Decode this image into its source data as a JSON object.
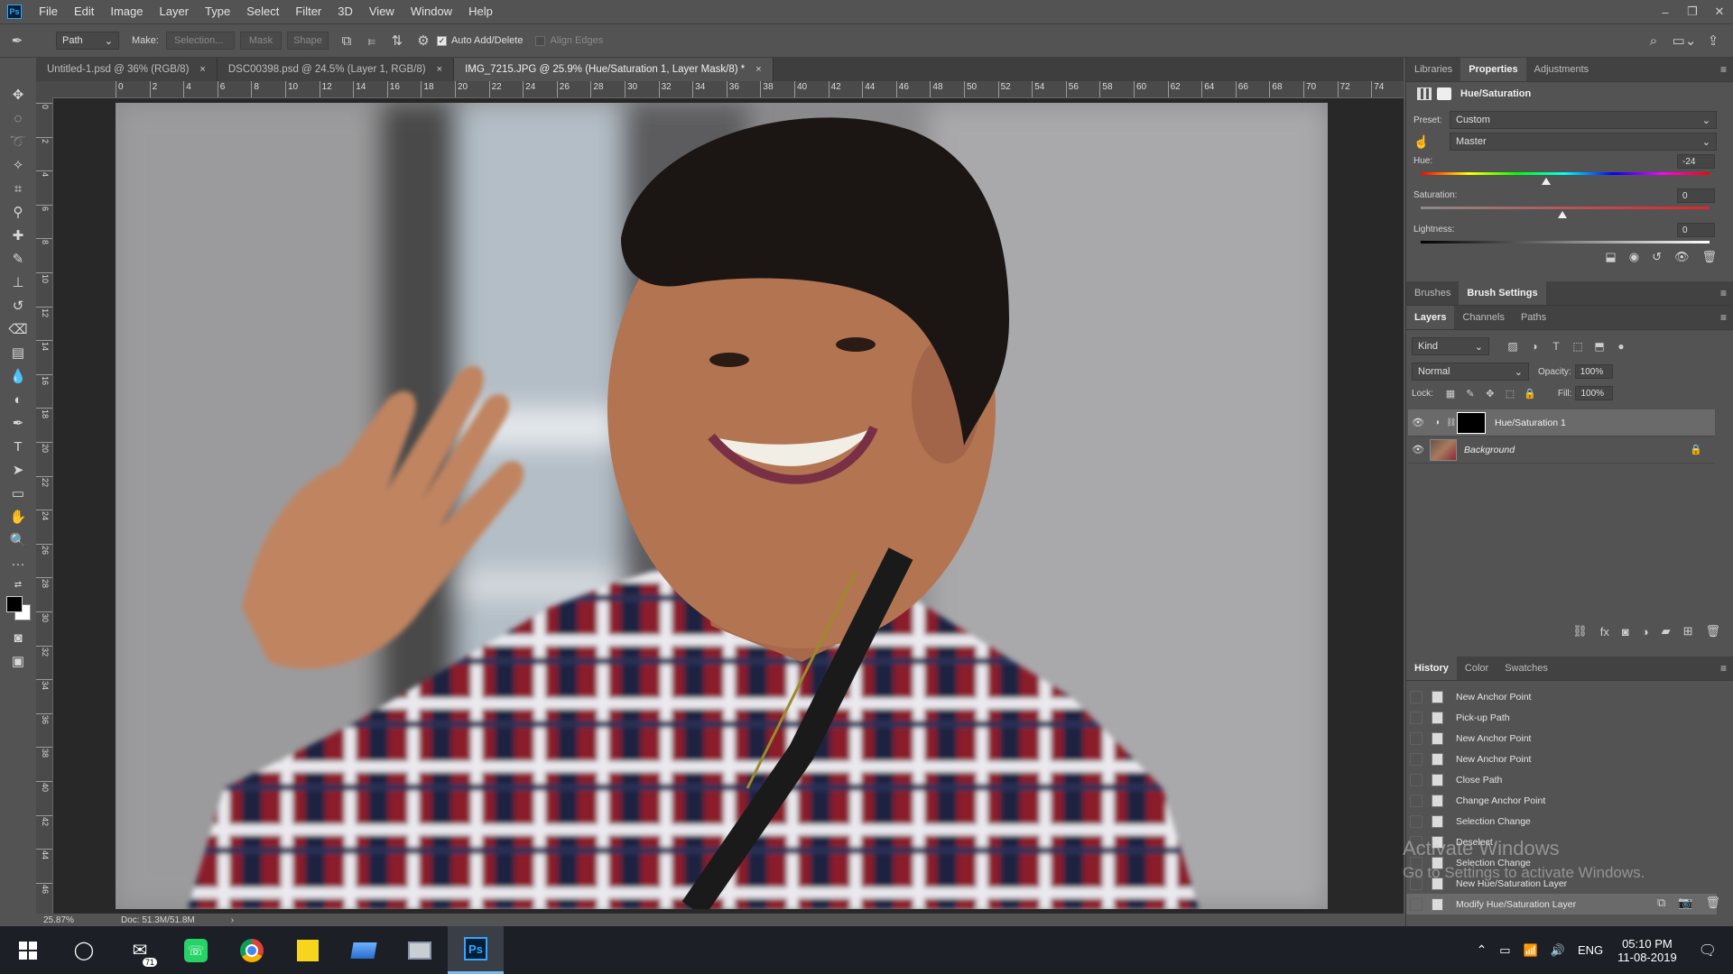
{
  "app": {
    "logo": "Ps"
  },
  "menu": [
    "File",
    "Edit",
    "Image",
    "Layer",
    "Type",
    "Select",
    "Filter",
    "3D",
    "View",
    "Window",
    "Help"
  ],
  "window_controls": {
    "minimize": "–",
    "restore": "❐",
    "close": "✕"
  },
  "options": {
    "tool_mode": "Path",
    "make_label": "Make:",
    "selection_btn": "Selection...",
    "mask_btn": "Mask",
    "shape_btn": "Shape",
    "auto_add_delete": "Auto Add/Delete",
    "align_edges": "Align Edges"
  },
  "tabs": [
    {
      "label": "Untitled-1.psd @ 36% (RGB/8)",
      "close": "×"
    },
    {
      "label": "DSC00398.psd @ 24.5% (Layer 1, RGB/8)",
      "close": "×"
    },
    {
      "label": "IMG_7215.JPG @ 25.9% (Hue/Saturation 1, Layer Mask/8) *",
      "close": "×"
    }
  ],
  "ruler_h": [
    "0",
    "2",
    "4",
    "6",
    "8",
    "10",
    "12",
    "14",
    "16",
    "18",
    "20",
    "22",
    "24",
    "26",
    "28",
    "30",
    "32",
    "34",
    "36",
    "38",
    "40",
    "42",
    "44",
    "46",
    "48",
    "50",
    "52",
    "54",
    "56",
    "58",
    "60",
    "62",
    "64",
    "66",
    "68",
    "70",
    "72",
    "74"
  ],
  "ruler_v": [
    "0",
    "2",
    "4",
    "6",
    "8",
    "10",
    "12",
    "14",
    "16",
    "18",
    "20",
    "22",
    "24",
    "26",
    "28",
    "30",
    "32",
    "34",
    "36",
    "38",
    "40",
    "42",
    "44",
    "46"
  ],
  "status": {
    "zoom": "25.87%",
    "doc": "Doc: 51.3M/51.8M",
    "arrow": "›"
  },
  "properties": {
    "tabs": [
      "Libraries",
      "Properties",
      "Adjustments"
    ],
    "title": "Hue/Saturation",
    "preset_label": "Preset:",
    "preset_value": "Custom",
    "channel_value": "Master",
    "hue_label": "Hue:",
    "hue_value": "-24",
    "hue_level": -24,
    "saturation_label": "Saturation:",
    "saturation_value": "0",
    "lightness_label": "Lightness:",
    "lightness_value": "0"
  },
  "brush_tabs": [
    "Brushes",
    "Brush Settings"
  ],
  "layers": {
    "tabs": [
      "Layers",
      "Channels",
      "Paths"
    ],
    "kind": "Kind",
    "blend": "Normal",
    "opacity_label": "Opacity:",
    "opacity_value": "100%",
    "lock_label": "Lock:",
    "fill_label": "Fill:",
    "fill_value": "100%",
    "items": [
      {
        "name": "Hue/Saturation 1"
      },
      {
        "name": "Background"
      }
    ]
  },
  "history": {
    "tabs": [
      "History",
      "Color",
      "Swatches"
    ],
    "items": [
      "New Anchor Point",
      "Pick-up Path",
      "New Anchor Point",
      "New Anchor Point",
      "Close Path",
      "Change Anchor Point",
      "Selection Change",
      "Deselect",
      "Selection Change",
      "New Hue/Saturation Layer",
      "Modify Hue/Saturation Layer"
    ]
  },
  "watermark": {
    "line1": "Activate Windows",
    "line2": "Go to Settings to activate Windows."
  },
  "taskbar": {
    "mail_badge": "71",
    "ps_label": "Ps",
    "lang": "ENG",
    "time": "05:10 PM",
    "date": "11-08-2019"
  },
  "colors": {
    "accent": "#31a8ff",
    "panel": "#535353",
    "dark": "#282828",
    "taskbar": "#1c1f26"
  }
}
